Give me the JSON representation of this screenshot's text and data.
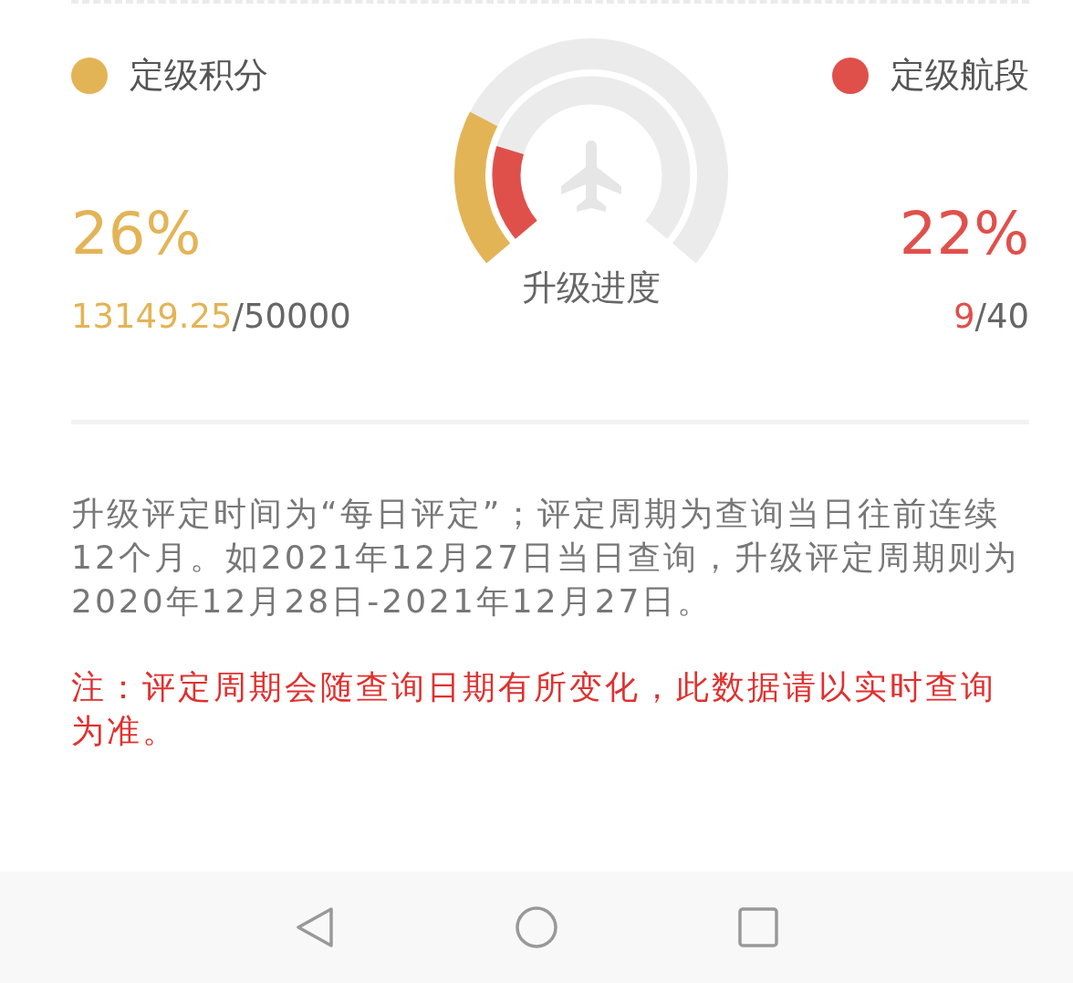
{
  "metrics": [
    {
      "label": "定级积分",
      "color": "#e3b456",
      "percent": "26%",
      "current": "13149.25",
      "total": "/50000"
    },
    {
      "label": "定级航段",
      "color": "#e0504b",
      "percent": "22%",
      "current": "9",
      "total": "/40"
    }
  ],
  "gauge": {
    "label": "升级进度"
  },
  "description": "升级评定时间为“每日评定”；评定周期为查询当日往前连续12个月。如2021年12月27日当日查询，升级评定周期则为2020年12月28日-2021年12月27日。",
  "note": "注：评定周期会随查询日期有所变化，此数据请以实时查询为准。",
  "nav_bar": [
    {
      "kind": "back"
    },
    {
      "kind": "home"
    },
    {
      "kind": "recents"
    }
  ]
}
